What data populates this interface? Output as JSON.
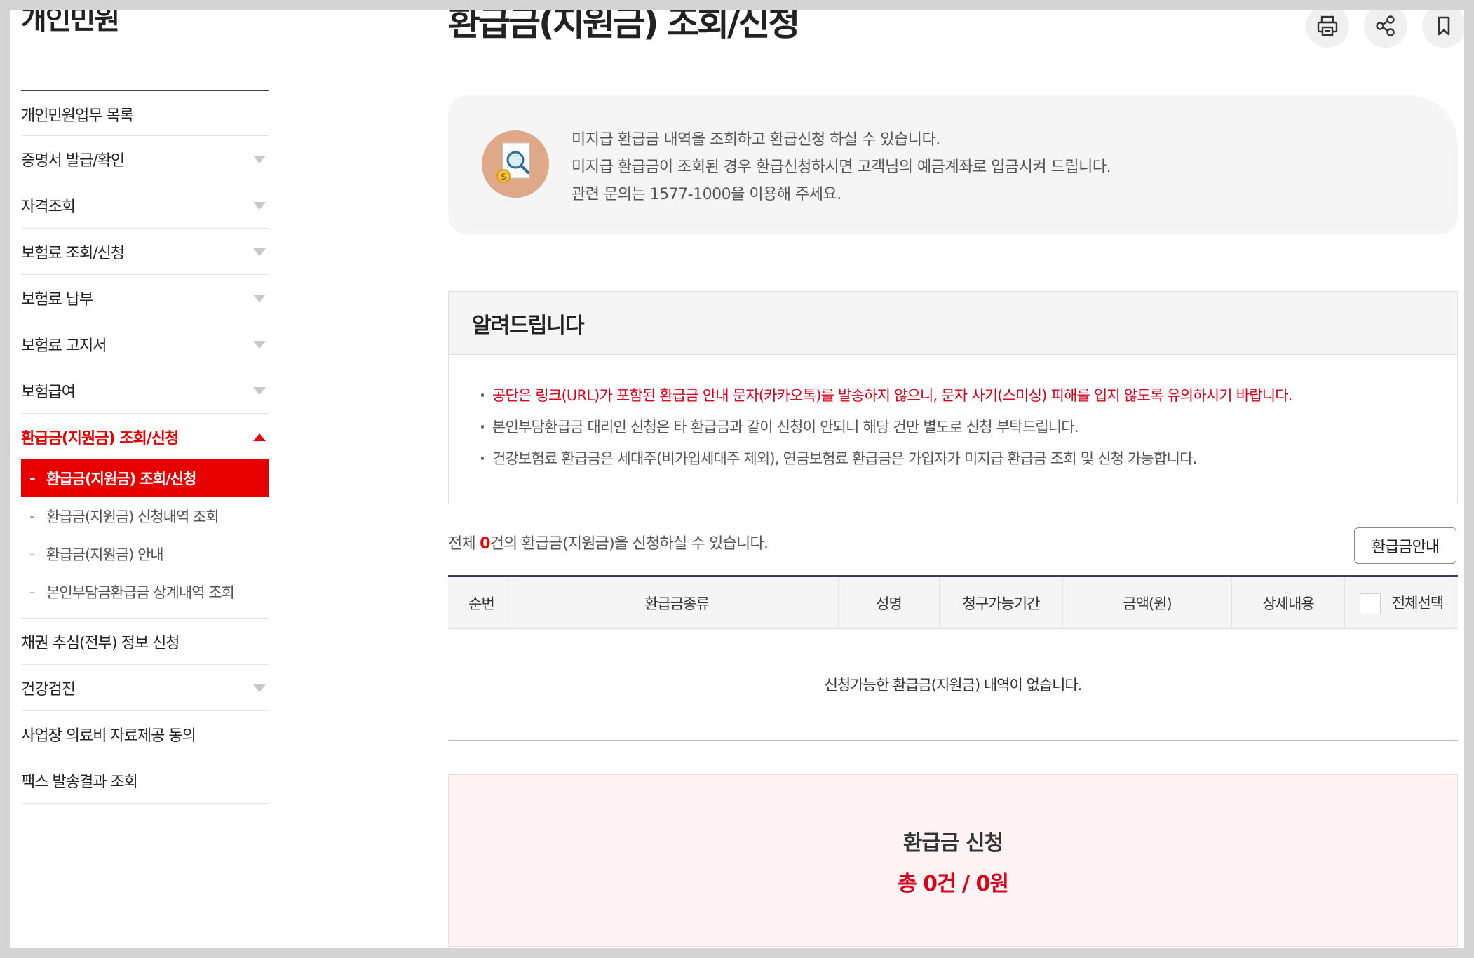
{
  "sidebar": {
    "title": "개인민원",
    "items": [
      {
        "label": "개인민원업무 목록"
      },
      {
        "label": "증명서 발급/확인"
      },
      {
        "label": "자격조회"
      },
      {
        "label": "보험료 조회/신청"
      },
      {
        "label": "보험료 납부"
      },
      {
        "label": "보험료 고지서"
      },
      {
        "label": "보험급여"
      },
      {
        "label": "환급금(지원금) 조회/신청"
      },
      {
        "label": "채권 추심(전부) 정보 신청"
      },
      {
        "label": "건강검진"
      },
      {
        "label": "사업장 의료비 자료제공 동의"
      },
      {
        "label": "팩스 발송결과 조회"
      }
    ],
    "sub_items": [
      {
        "dash": "-",
        "label": "환급금(지원금) 조회/신청"
      },
      {
        "dash": "-",
        "label": "환급금(지원금) 신청내역 조회"
      },
      {
        "dash": "-",
        "label": "환급금(지원금) 안내"
      },
      {
        "dash": "-",
        "label": "본인부담금환급금 상계내역 조회"
      }
    ]
  },
  "page": {
    "title": "환급금(지원금) 조회/신청",
    "tools": {
      "print_icon": "printer-icon",
      "share_icon": "share-icon",
      "bookmark_icon": "bookmark-icon"
    }
  },
  "intro": {
    "line1": "미지급 환급금 내역을 조회하고 환급신청 하실 수 있습니다.",
    "line2": "미지급 환급금이 조회된 경우 환급신청하시면 고객님의 예금계좌로 입금시켜 드립니다.",
    "line3": "관련 문의는 1577-1000을 이용해 주세요."
  },
  "notice": {
    "title": "알려드립니다",
    "items": [
      "공단은 링크(URL)가 포함된 환급금 안내 문자(카카오톡)를 발송하지 않으니, 문자 사기(스미싱) 피해를 입지 않도록 유의하시기 바랍니다.",
      "본인부담환급금 대리인 신청은 타 환급금과 같이 신청이 안되니 해당 건만 별도로 신청 부탁드립니다.",
      "건강보험료 환급금은 세대주(비가입세대주 제외), 연금보험료 환급금은 가입자가 미지급 환급금 조회 및 신청 가능합니다."
    ]
  },
  "summary": {
    "prefix": "전체 ",
    "count": "0",
    "suffix": "건의 환급금(지원금)을 신청하실 수 있습니다.",
    "guide_button": "환급금안내"
  },
  "table": {
    "headers": [
      "순번",
      "환급금종류",
      "성명",
      "청구가능기간",
      "금액(원)",
      "상세내용",
      "전체선택"
    ],
    "empty_message": "신청가능한 환급금(지원금) 내역이 없습니다."
  },
  "apply": {
    "title": "환급금 신청",
    "total": "총 0건 / 0원"
  },
  "colors": {
    "accent_red": "#e50000",
    "sub_active_bg": "#e80000",
    "apply_bg": "#fff3f3"
  }
}
